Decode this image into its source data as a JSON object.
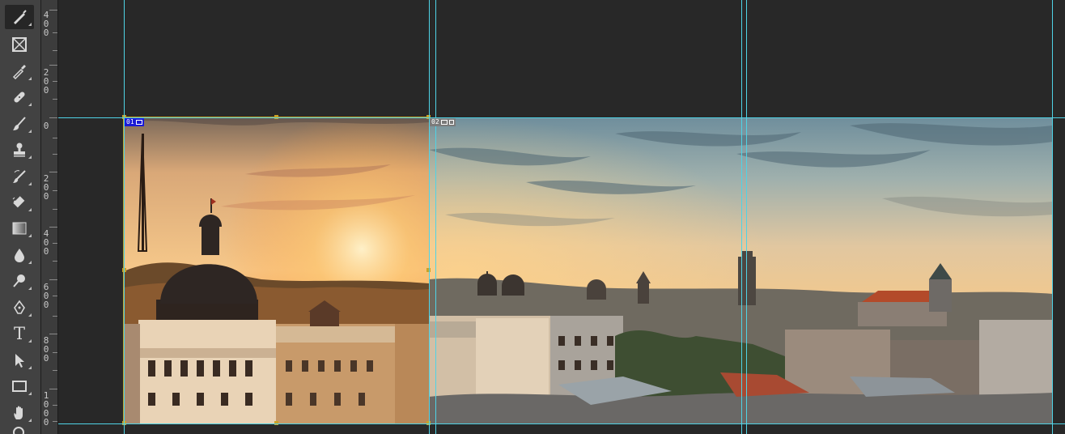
{
  "app": {
    "tools": [
      {
        "name": "brush-tool",
        "icon": "brush-icon",
        "active": true
      },
      {
        "name": "frame-tool",
        "icon": "frame-icon"
      },
      {
        "name": "eyedropper-tool",
        "icon": "eyedropper-icon"
      },
      {
        "name": "spot-healing-tool",
        "icon": "bandage-icon"
      },
      {
        "name": "brush-tool-2",
        "icon": "paintbrush-icon"
      },
      {
        "name": "clone-stamp-tool",
        "icon": "stamp-icon"
      },
      {
        "name": "history-brush-tool",
        "icon": "history-brush-icon"
      },
      {
        "name": "eraser-tool",
        "icon": "eraser-icon"
      },
      {
        "name": "gradient-tool",
        "icon": "gradient-icon"
      },
      {
        "name": "blur-tool",
        "icon": "drop-icon"
      },
      {
        "name": "dodge-tool",
        "icon": "dodge-icon"
      },
      {
        "name": "pen-tool",
        "icon": "pen-icon"
      },
      {
        "name": "type-tool",
        "icon": "type-icon",
        "glyph": "T"
      },
      {
        "name": "path-selection-tool",
        "icon": "arrow-icon"
      },
      {
        "name": "rectangle-tool",
        "icon": "rectangle-icon"
      },
      {
        "name": "hand-tool",
        "icon": "hand-icon"
      },
      {
        "name": "zoom-tool",
        "icon": "zoom-icon"
      }
    ],
    "ruler_labels": [
      "4\n0\n0",
      "2\n0\n0",
      "0",
      "2\n0\n0",
      "4\n0\n0",
      "6\n0\n0",
      "8\n0\n0",
      "1\n0\n0\n0"
    ],
    "frames": [
      {
        "label": "01",
        "color": "#1a1ad6"
      },
      {
        "label": "02",
        "color": "#7b7b7b"
      }
    ]
  }
}
